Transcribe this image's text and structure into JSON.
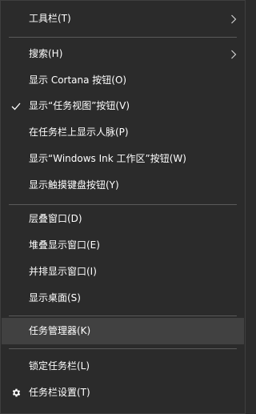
{
  "menu": {
    "items": [
      {
        "label": "工具栏(T)"
      },
      {
        "label": "搜索(H)"
      },
      {
        "label": "显示 Cortana 按钮(O)"
      },
      {
        "label": "显示“任务视图”按钮(V)"
      },
      {
        "label": "在任务栏上显示人脉(P)"
      },
      {
        "label": "显示“Windows Ink 工作区”按钮(W)"
      },
      {
        "label": "显示触摸键盘按钮(Y)"
      },
      {
        "label": "层叠窗口(D)"
      },
      {
        "label": "堆叠显示窗口(E)"
      },
      {
        "label": "并排显示窗口(I)"
      },
      {
        "label": "显示桌面(S)"
      },
      {
        "label": "任务管理器(K)"
      },
      {
        "label": "锁定任务栏(L)"
      },
      {
        "label": "任务栏设置(T)"
      }
    ]
  },
  "icons": {
    "submenu": "chevron-right-icon",
    "checked": "checkmark-icon",
    "settings": "gear-icon"
  },
  "colors": {
    "background": "#2b2b2b",
    "text": "#ffffff",
    "highlight": "#414141",
    "separator": "#5a5a5a"
  }
}
